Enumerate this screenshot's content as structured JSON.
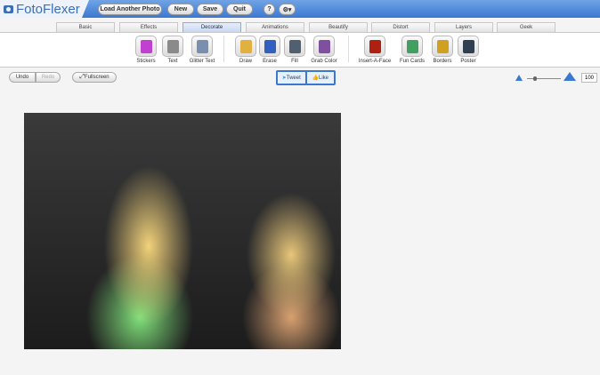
{
  "app": {
    "title": "FotoFlexer"
  },
  "topbar": {
    "load": "Load Another Photo",
    "new": "New",
    "save": "Save",
    "quit": "Quit",
    "help": "?",
    "settings": "⚙▾"
  },
  "tabs": [
    "Basic",
    "Effects",
    "Decorate",
    "Animations",
    "Beautify",
    "Distort",
    "Layers",
    "Geek"
  ],
  "active_tab": "Decorate",
  "tools": [
    {
      "label": "Stickers",
      "icon": "stickers-icon",
      "color": "#c040d0"
    },
    {
      "label": "Text",
      "icon": "text-icon",
      "color": "#8a8a8a"
    },
    {
      "label": "Glitter Text",
      "icon": "glitter-text-icon",
      "color": "#7a8fb0"
    },
    {
      "label": "Draw",
      "icon": "pencil-icon",
      "color": "#e0b040"
    },
    {
      "label": "Erase",
      "icon": "eraser-icon",
      "color": "#3060c0"
    },
    {
      "label": "Fill",
      "icon": "paint-bucket-icon",
      "color": "#506070"
    },
    {
      "label": "Grab Color",
      "icon": "eyedropper-icon",
      "color": "#8050a0"
    },
    {
      "label": "Insert-A-Face",
      "icon": "insert-face-icon",
      "color": "#b02010"
    },
    {
      "label": "Fun Cards",
      "icon": "fun-cards-icon",
      "color": "#40a060"
    },
    {
      "label": "Borders",
      "icon": "borders-icon",
      "color": "#d0a020"
    },
    {
      "label": "Poster",
      "icon": "poster-icon",
      "color": "#304050"
    }
  ],
  "actions": {
    "undo": "Undo",
    "redo": "Redo",
    "fullscreen": "Fullscreen"
  },
  "social": {
    "tweet": "Tweet",
    "like": "Like"
  },
  "zoom": {
    "value": "100"
  }
}
